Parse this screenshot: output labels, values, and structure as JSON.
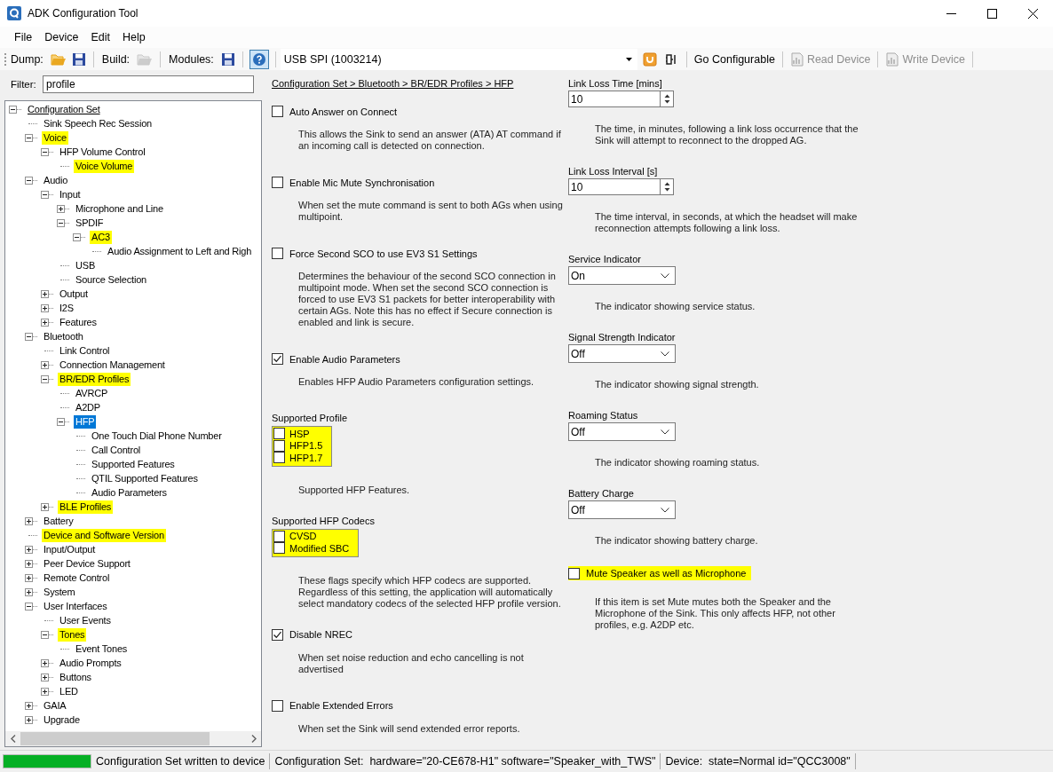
{
  "window": {
    "title": "ADK Configuration Tool"
  },
  "menu": [
    {
      "label": "File"
    },
    {
      "label": "Device"
    },
    {
      "label": "Edit"
    },
    {
      "label": "Help"
    }
  ],
  "toolbar": {
    "dump_label": "Dump:",
    "build_label": "Build:",
    "modules_label": "Modules:",
    "port": "USB SPI (1003214)",
    "buttons": [
      {
        "label": "Go Configurable",
        "disabled": false
      },
      {
        "label": "Read Device",
        "disabled": true
      },
      {
        "label": "Write Device",
        "disabled": true
      }
    ]
  },
  "filter": {
    "label": "Filter:",
    "value": "profile"
  },
  "tree": [
    {
      "label": "Configuration Set",
      "expanded": true,
      "highlighted": false,
      "selected": false,
      "children": [
        {
          "label": "Sink Speech Rec Session",
          "highlighted": false,
          "selected": false
        },
        {
          "label": "Voice",
          "expanded": true,
          "highlighted": true,
          "selected": false,
          "children": [
            {
              "label": "HFP Volume Control",
              "expanded": true,
              "highlighted": false,
              "selected": false,
              "children": [
                {
                  "label": "Voice Volume",
                  "highlighted": true,
                  "selected": false
                }
              ]
            }
          ]
        },
        {
          "label": "Audio",
          "expanded": true,
          "highlighted": false,
          "selected": false,
          "children": [
            {
              "label": "Input",
              "expanded": true,
              "highlighted": false,
              "selected": false,
              "children": [
                {
                  "label": "Microphone and Line",
                  "expanded": false,
                  "highlighted": false,
                  "selected": false
                },
                {
                  "label": "SPDIF",
                  "expanded": true,
                  "highlighted": false,
                  "selected": false,
                  "children": [
                    {
                      "label": "AC3",
                      "expanded": true,
                      "highlighted": true,
                      "selected": false,
                      "children": [
                        {
                          "label": "Audio Assignment to Left and Righ",
                          "highlighted": false,
                          "selected": false
                        }
                      ]
                    }
                  ]
                },
                {
                  "label": "USB",
                  "highlighted": false,
                  "selected": false
                },
                {
                  "label": "Source Selection",
                  "highlighted": false,
                  "selected": false
                }
              ]
            },
            {
              "label": "Output",
              "expanded": false,
              "highlighted": false,
              "selected": false
            },
            {
              "label": "I2S",
              "expanded": false,
              "highlighted": false,
              "selected": false
            },
            {
              "label": "Features",
              "expanded": false,
              "highlighted": false,
              "selected": false
            }
          ]
        },
        {
          "label": "Bluetooth",
          "expanded": true,
          "highlighted": false,
          "selected": false,
          "children": [
            {
              "label": "Link Control",
              "highlighted": false,
              "selected": false
            },
            {
              "label": "Connection Management",
              "expanded": false,
              "highlighted": false,
              "selected": false
            },
            {
              "label": "BR/EDR Profiles",
              "expanded": true,
              "highlighted": true,
              "selected": false,
              "children": [
                {
                  "label": "AVRCP",
                  "highlighted": false,
                  "selected": false
                },
                {
                  "label": "A2DP",
                  "highlighted": false,
                  "selected": false
                },
                {
                  "label": "HFP",
                  "expanded": true,
                  "highlighted": false,
                  "selected": true,
                  "children": [
                    {
                      "label": "One Touch Dial Phone Number",
                      "highlighted": false,
                      "selected": false
                    },
                    {
                      "label": "Call Control",
                      "highlighted": false,
                      "selected": false
                    },
                    {
                      "label": "Supported Features",
                      "highlighted": false,
                      "selected": false
                    },
                    {
                      "label": "QTIL Supported Features",
                      "highlighted": false,
                      "selected": false
                    },
                    {
                      "label": "Audio Parameters",
                      "highlighted": false,
                      "selected": false
                    }
                  ]
                }
              ]
            },
            {
              "label": "BLE Profiles",
              "expanded": false,
              "highlighted": true,
              "selected": false
            }
          ]
        },
        {
          "label": "Battery",
          "expanded": false,
          "highlighted": false,
          "selected": false
        },
        {
          "label": "Device and Software Version",
          "highlighted": true,
          "selected": false
        },
        {
          "label": "Input/Output",
          "expanded": false,
          "highlighted": false,
          "selected": false
        },
        {
          "label": "Peer Device Support",
          "expanded": false,
          "highlighted": false,
          "selected": false
        },
        {
          "label": "Remote Control",
          "expanded": false,
          "highlighted": false,
          "selected": false
        },
        {
          "label": "System",
          "expanded": false,
          "highlighted": false,
          "selected": false
        },
        {
          "label": "User Interfaces",
          "expanded": true,
          "highlighted": false,
          "selected": false,
          "children": [
            {
              "label": "User Events",
              "highlighted": false,
              "selected": false
            },
            {
              "label": "Tones",
              "expanded": true,
              "highlighted": true,
              "selected": false,
              "children": [
                {
                  "label": "Event Tones",
                  "highlighted": false,
                  "selected": false
                }
              ]
            },
            {
              "label": "Audio Prompts",
              "expanded": false,
              "highlighted": false,
              "selected": false
            },
            {
              "label": "Buttons",
              "expanded": false,
              "highlighted": false,
              "selected": false
            },
            {
              "label": "LED",
              "expanded": false,
              "highlighted": false,
              "selected": false
            }
          ]
        },
        {
          "label": "GAIA",
          "expanded": false,
          "highlighted": false,
          "selected": false
        },
        {
          "label": "Upgrade",
          "expanded": false,
          "highlighted": false,
          "selected": false
        }
      ]
    }
  ],
  "editor": {
    "breadcrumb": "Configuration Set > Bluetooth > BR/EDR Profiles > HFP",
    "left": [
      {
        "kind": "checkbox",
        "label": "Auto Answer on Connect",
        "checked": false,
        "highlighted": false,
        "description": "This allows the Sink to send an answer (ATA) AT command if an incoming call is detected on connection."
      },
      {
        "kind": "checkbox",
        "label": "Enable Mic Mute Synchronisation",
        "checked": false,
        "highlighted": false,
        "description": "When set the mute command is sent to both AGs when using multipoint."
      },
      {
        "kind": "checkbox",
        "label": "Force Second SCO to use EV3 S1 Settings",
        "checked": false,
        "highlighted": false,
        "description": "Determines the behaviour of the second SCO connection in multipoint mode. When set the second SCO connection is forced to use EV3 S1 packets for better interoperability with certain AGs.              Note this has no effect if Secure connection is enabled and link is secure."
      },
      {
        "kind": "checkbox",
        "label": "Enable Audio Parameters",
        "checked": true,
        "highlighted": false,
        "description": "Enables HFP Audio Parameters configuration settings."
      },
      {
        "kind": "flags",
        "title": "Supported Profile",
        "highlighted": true,
        "options": [
          {
            "label": "HSP",
            "checked": false
          },
          {
            "label": "HFP1.5",
            "checked": false
          },
          {
            "label": "HFP1.7",
            "checked": false
          }
        ],
        "description": "Supported HFP Features."
      },
      {
        "kind": "flags",
        "title": "Supported HFP Codecs",
        "highlighted": true,
        "options": [
          {
            "label": "CVSD",
            "checked": false
          },
          {
            "label": "Modified SBC",
            "checked": false
          }
        ],
        "description": "These flags specify which HFP codecs are supported. Regardless of this setting, the application will automatically select mandatory codecs of the selected HFP profile version."
      },
      {
        "kind": "checkbox",
        "label": "Disable NREC",
        "checked": true,
        "highlighted": false,
        "description": "When set noise reduction and echo cancelling is not advertised"
      },
      {
        "kind": "checkbox",
        "label": "Enable Extended Errors",
        "checked": false,
        "highlighted": false,
        "description": "When set the Sink will send extended error reports."
      }
    ],
    "right": [
      {
        "kind": "spin",
        "label": "Link Loss Time [mins]",
        "value": "10",
        "description": "The time, in minutes, following a link loss occurrence that the Sink will attempt to reconnect to the dropped AG."
      },
      {
        "kind": "spin",
        "label": "Link Loss Interval [s]",
        "value": "10",
        "description": "The time interval, in seconds, at which the headset will make reconnection attempts following a link loss."
      },
      {
        "kind": "dropdown",
        "label": "Service Indicator",
        "value": "On",
        "description": "The indicator showing service status."
      },
      {
        "kind": "dropdown",
        "label": "Signal Strength Indicator",
        "value": "Off",
        "description": "The indicator showing signal strength."
      },
      {
        "kind": "dropdown",
        "label": "Roaming Status",
        "value": "Off",
        "description": "The indicator showing roaming status."
      },
      {
        "kind": "dropdown",
        "label": "Battery Charge",
        "value": "Off",
        "description": "The indicator showing battery charge."
      },
      {
        "kind": "checkbox",
        "label": "Mute Speaker as well as Microphone",
        "checked": false,
        "highlighted": true,
        "description": "If this item is set Mute mutes both the Speaker and the Microphone of the Sink. This only affects HFP, not other profiles, e.g. A2DP etc."
      }
    ]
  },
  "status_bar": {
    "level": 1,
    "message": "Configuration Set written to device",
    "config_set": "Configuration Set:  hardware=\"20-CE678-H1\" software=\"Speaker_with_TWS\"",
    "device": "Device:  state=Normal id=\"QCC3008\""
  }
}
